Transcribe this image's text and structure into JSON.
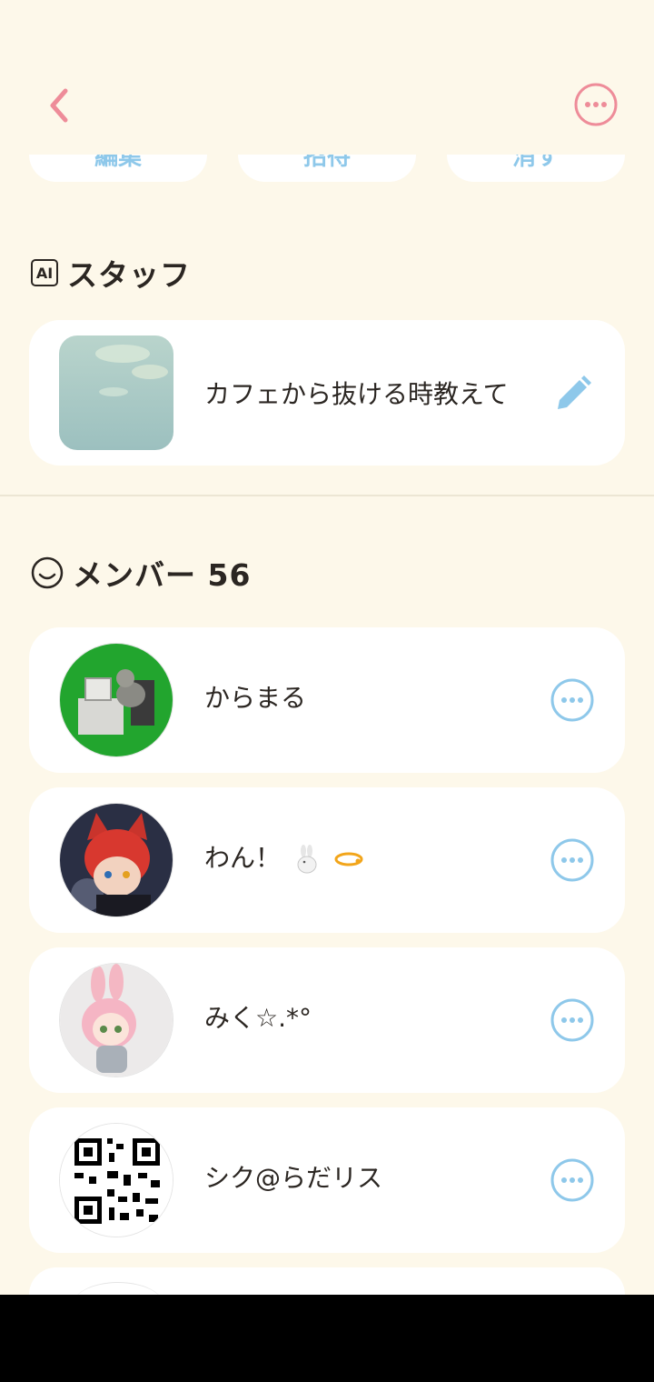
{
  "colors": {
    "background": "#fdf8ea",
    "accent_pink": "#ee8c99",
    "accent_blue": "#8ec8ea",
    "text": "#2b2622"
  },
  "header": {
    "back_icon": "chevron-left-icon",
    "more_icon": "more-icon"
  },
  "action_pills": [
    {
      "label": "編集"
    },
    {
      "label": "招待"
    },
    {
      "label": "消す"
    }
  ],
  "staff": {
    "title": "スタッフ",
    "ai_badge": "AI",
    "item": {
      "name": "カフェから抜ける時教えて",
      "edit_icon": "pencil-icon"
    }
  },
  "members": {
    "title": "メンバー 56",
    "items": [
      {
        "name": "からまる"
      },
      {
        "name": "わん！"
      },
      {
        "name": "みく☆.*°"
      },
      {
        "name": "シク@らだリス"
      }
    ]
  }
}
